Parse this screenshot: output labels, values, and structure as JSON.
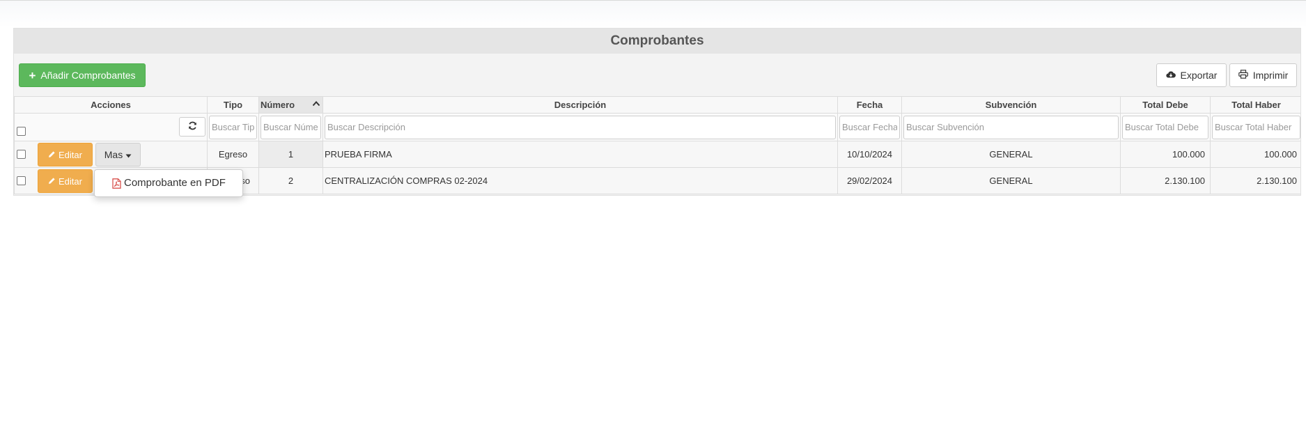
{
  "page": {
    "title": "Comprobantes"
  },
  "toolbar": {
    "add_label": "Añadir Comprobantes",
    "export_label": "Exportar",
    "print_label": "Imprimir"
  },
  "columns": {
    "acciones": "Acciones",
    "tipo": "Tipo",
    "numero": "Número",
    "descripcion": "Descripción",
    "fecha": "Fecha",
    "subvencion": "Subvención",
    "total_debe": "Total Debe",
    "total_haber": "Total Haber"
  },
  "filters": {
    "tipo": "Buscar Tipo",
    "numero": "Buscar Número",
    "descripcion": "Buscar Descripción",
    "fecha": "Buscar Fecha",
    "subvencion": "Buscar Subvención",
    "total_debe": "Buscar Total Debe",
    "total_haber": "Buscar Total Haber"
  },
  "rows": [
    {
      "edit_label": "Editar",
      "more_label": "Mas",
      "tipo": "Egreso",
      "numero": "1",
      "descripcion": "PRUEBA FIRMA",
      "fecha": "10/10/2024",
      "subvencion": "GENERAL",
      "total_debe": "100.000",
      "total_haber": "100.000"
    },
    {
      "edit_label": "Editar",
      "tipo_partial": "so",
      "numero": "2",
      "descripcion": "CENTRALIZACIÓN COMPRAS 02-2024",
      "fecha": "29/02/2024",
      "subvencion": "GENERAL",
      "total_debe": "2.130.100",
      "total_haber": "2.130.100"
    }
  ],
  "dropdown": {
    "item_pdf": "Comprobante en PDF"
  },
  "colors": {
    "add_button": "#5cb85c",
    "edit_button": "#f0ad4e",
    "header_bar": "#e5e5e5",
    "pdf_icon": "#d9534f"
  }
}
